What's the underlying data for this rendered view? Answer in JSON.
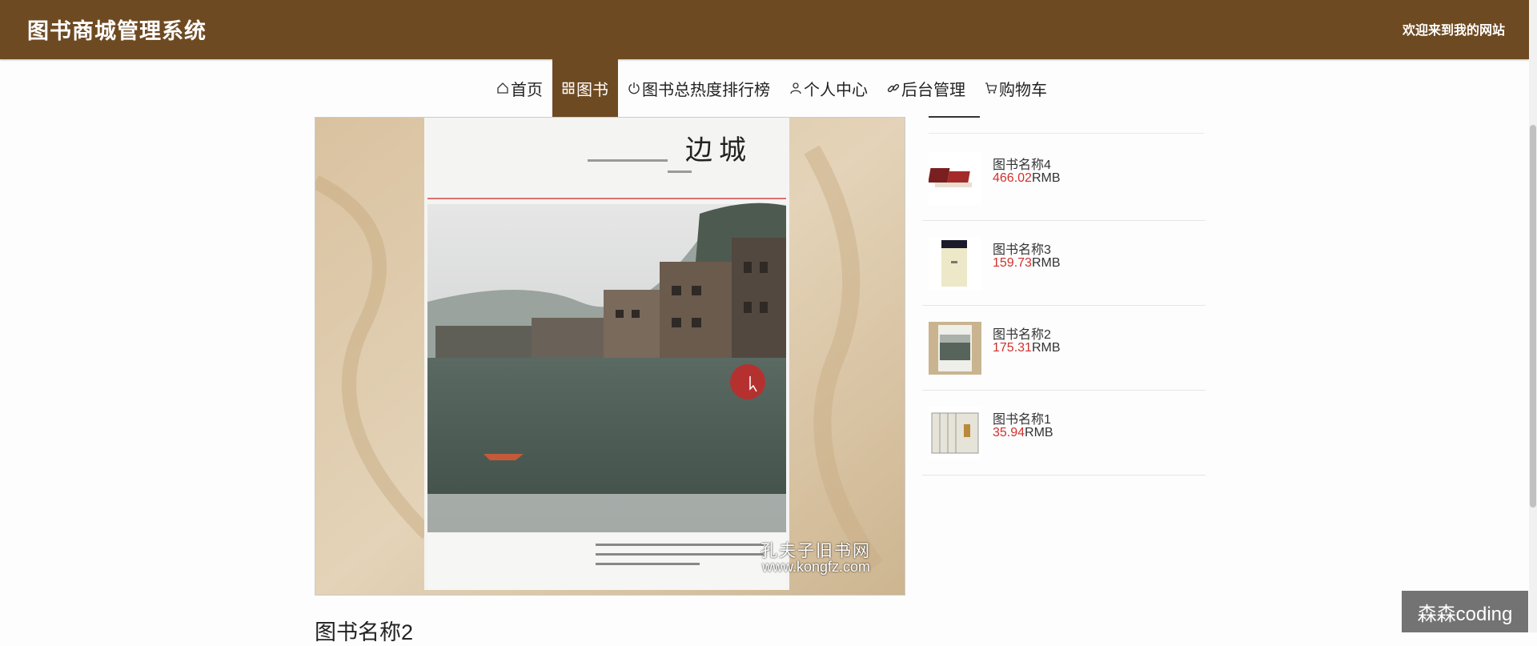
{
  "header": {
    "site_title": "图书商城管理系统",
    "welcome": "欢迎来到我的网站"
  },
  "nav": {
    "items": [
      {
        "label": "首页",
        "icon": "home-icon"
      },
      {
        "label": "图书",
        "icon": "grid-icon",
        "active": true
      },
      {
        "label": "图书总热度排行榜",
        "icon": "power-icon"
      },
      {
        "label": "个人中心",
        "icon": "user-icon"
      },
      {
        "label": "后台管理",
        "icon": "link-icon"
      },
      {
        "label": "购物车",
        "icon": "cart-icon"
      }
    ]
  },
  "main": {
    "cover_title": "边城",
    "watermark_cn": "孔夫子旧书网",
    "watermark_url": "www.kongfz.com",
    "book_name": "图书名称2"
  },
  "sidebar": {
    "currency": "RMB",
    "items": [
      {
        "name": "图书名称4",
        "price": "466.02"
      },
      {
        "name": "图书名称3",
        "price": "159.73"
      },
      {
        "name": "图书名称2",
        "price": "175.31"
      },
      {
        "name": "图书名称1",
        "price": "35.94"
      }
    ]
  },
  "corner_badge": "森森coding",
  "colors": {
    "header_bg": "#6e4a22",
    "price_red": "#d0312d"
  }
}
